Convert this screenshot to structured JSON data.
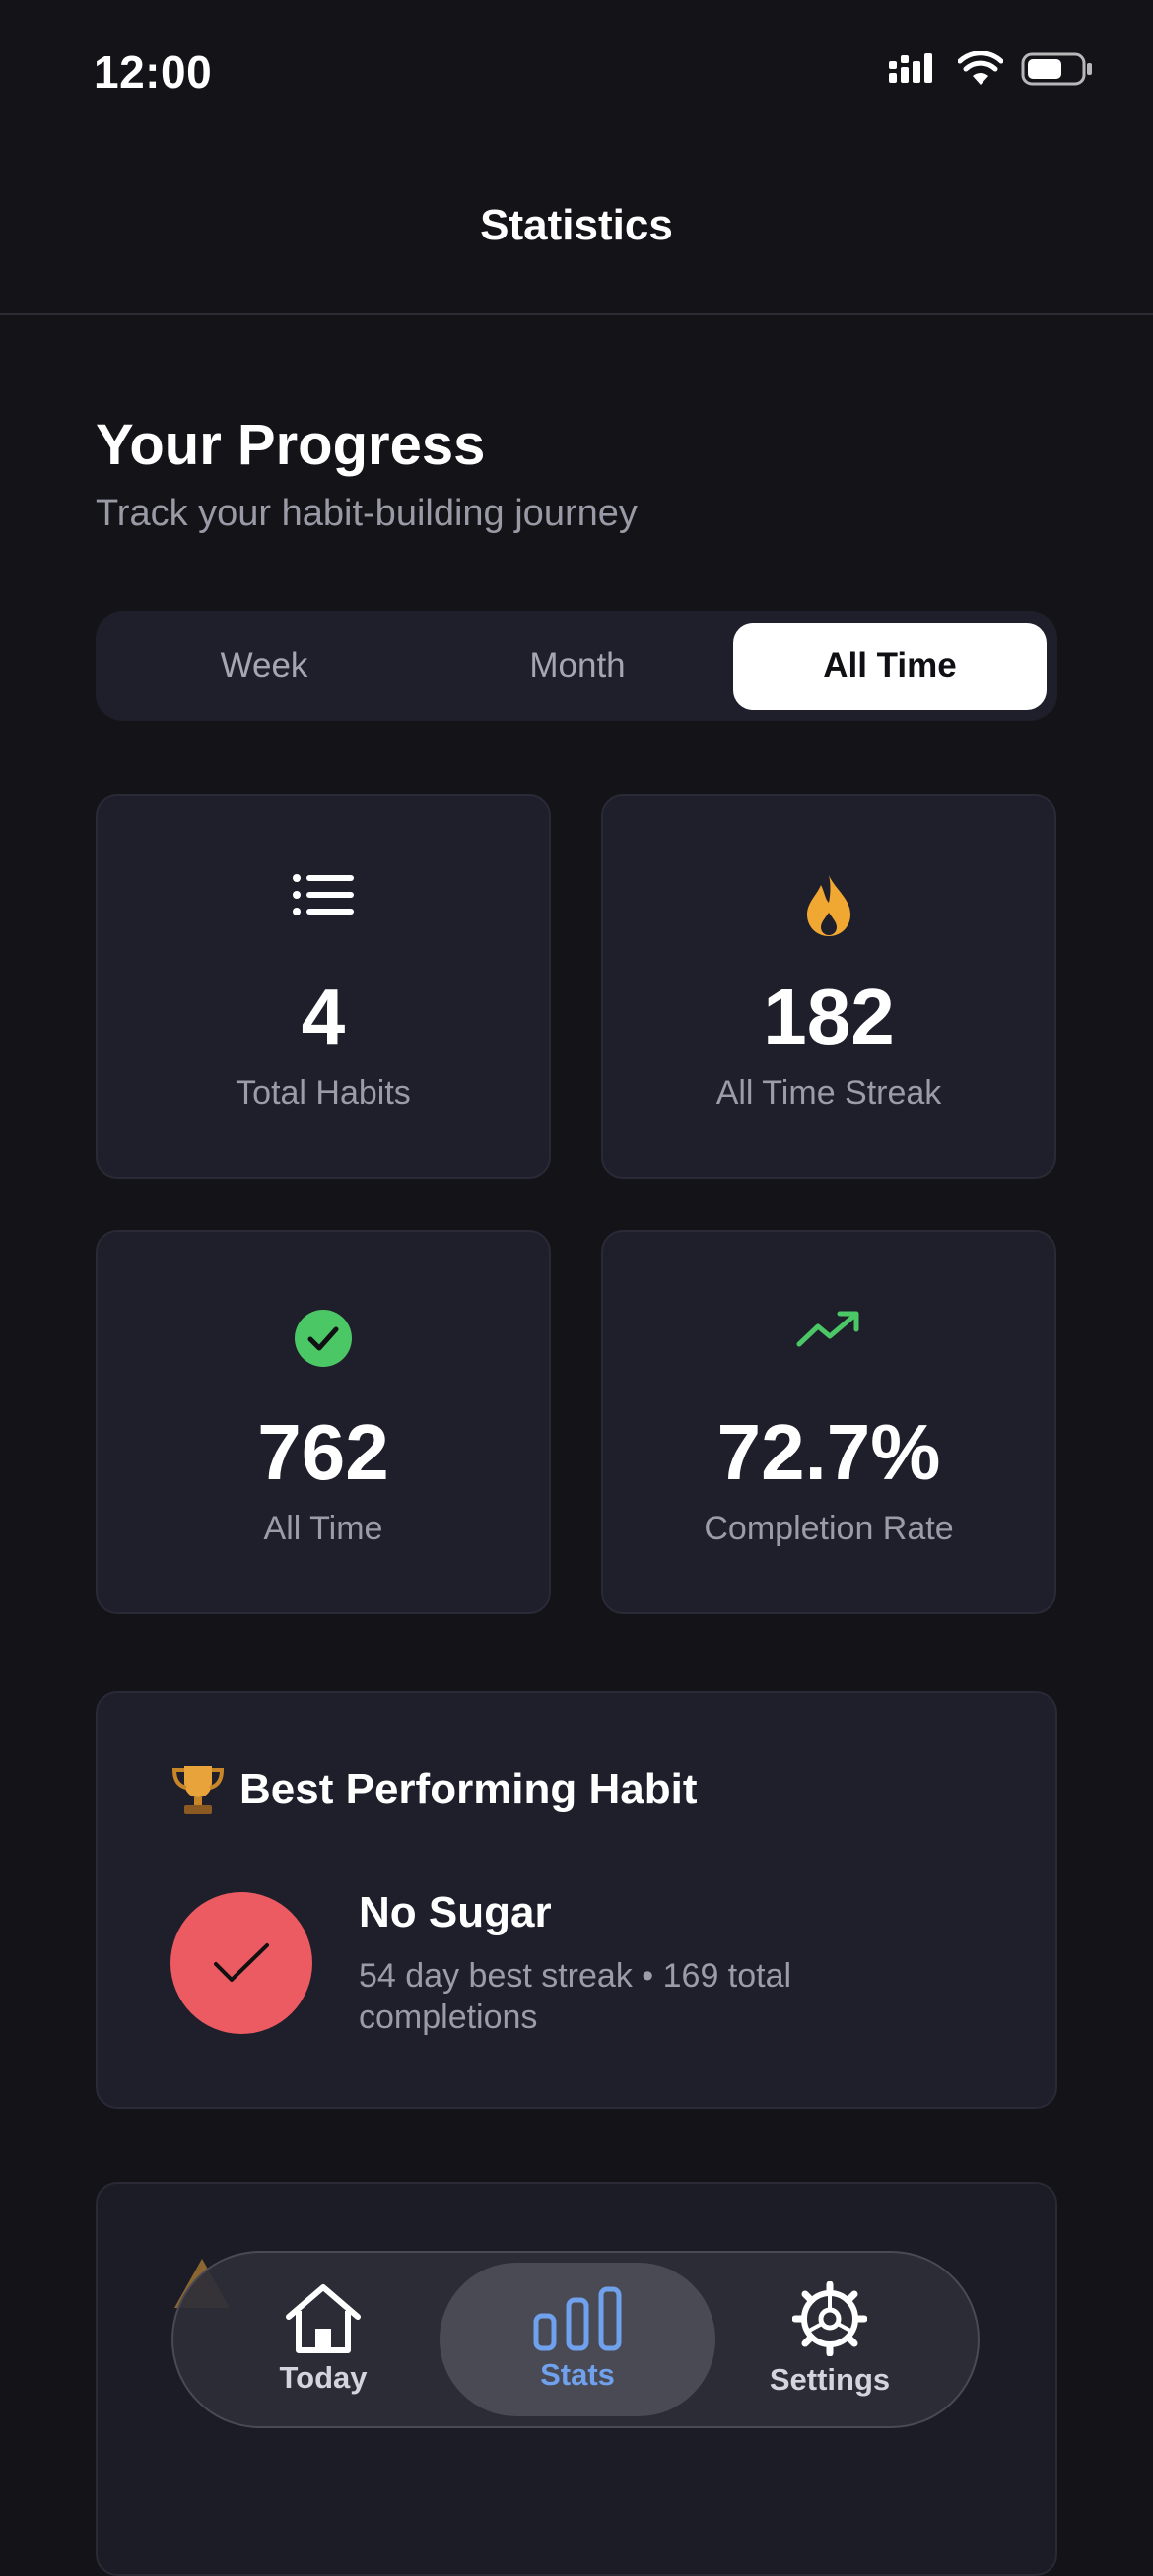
{
  "status_bar": {
    "time": "12:00",
    "icons": [
      "signal-icon",
      "wifi-icon",
      "battery-icon"
    ]
  },
  "header": {
    "title": "Statistics"
  },
  "progress": {
    "title": "Your Progress",
    "subtitle": "Track your habit-building journey"
  },
  "period_tabs": {
    "items": [
      {
        "label": "Week",
        "selected": false
      },
      {
        "label": "Month",
        "selected": false
      },
      {
        "label": "All Time",
        "selected": true
      }
    ]
  },
  "stats": [
    {
      "icon": "list-icon",
      "value": "4",
      "label": "Total Habits"
    },
    {
      "icon": "flame-icon",
      "value": "182",
      "label": "All Time Streak"
    },
    {
      "icon": "check-circle-icon",
      "value": "762",
      "label": "All Time"
    },
    {
      "icon": "trending-up-icon",
      "value": "72.7%",
      "label": "Completion Rate"
    }
  ],
  "best_habit": {
    "title": "Best Performing Habit",
    "icon": "trophy-icon",
    "name": "No Sugar",
    "detail": "54 day best streak • 169 total completions"
  },
  "tab_bar": {
    "items": [
      {
        "label": "Today",
        "icon": "home-icon",
        "active": false
      },
      {
        "label": "Stats",
        "icon": "bar-chart-icon",
        "active": true
      },
      {
        "label": "Settings",
        "icon": "settings-icon",
        "active": false
      }
    ]
  },
  "colors": {
    "background": "#131318",
    "card": "#1f1f2c",
    "accent_blue": "#6fa1ec",
    "flame": "#f0a832",
    "success": "#4cc765",
    "habit_red": "#ec5a62"
  }
}
